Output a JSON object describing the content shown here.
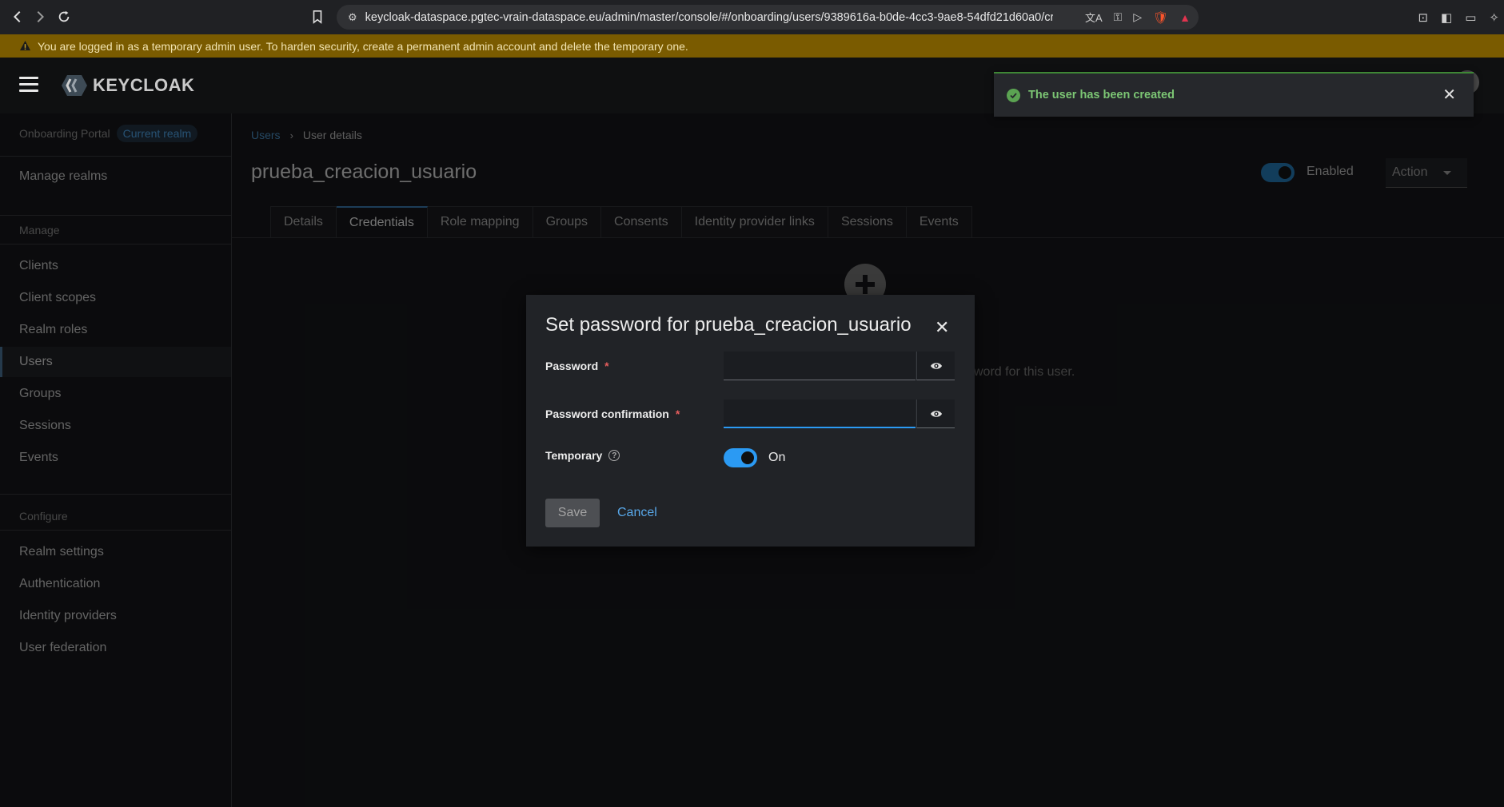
{
  "browser": {
    "url": "keycloak-dataspace.pgtec-vrain-dataspace.eu/admin/master/console/#/onboarding/users/9389616a-b0de-4cc3-9ae8-54dfd21d60a0/cre..."
  },
  "banner": {
    "text": "You are logged in as a temporary admin user. To harden security, create a permanent admin account and delete the temporary one."
  },
  "header": {
    "logo_text": "KEYCLOAK"
  },
  "toast": {
    "message": "The user has been created",
    "status_color": "#3e8635"
  },
  "sidebar": {
    "realm_name": "Onboarding Portal",
    "realm_badge": "Current realm",
    "manage_realms": "Manage realms",
    "section_manage": "Manage",
    "section_configure": "Configure",
    "items": [
      {
        "label": "Clients"
      },
      {
        "label": "Client scopes"
      },
      {
        "label": "Realm roles"
      },
      {
        "label": "Users",
        "active": true
      },
      {
        "label": "Groups"
      },
      {
        "label": "Sessions"
      },
      {
        "label": "Events"
      }
    ],
    "configure_items": [
      {
        "label": "Realm settings"
      },
      {
        "label": "Authentication"
      },
      {
        "label": "Identity providers"
      },
      {
        "label": "User federation"
      }
    ]
  },
  "main": {
    "breadcrumb": {
      "parent": "Users",
      "current": "User details"
    },
    "title": "prueba_creacion_usuario",
    "enabled_label": "Enabled",
    "enabled": true,
    "action_label": "Action",
    "tabs": [
      {
        "label": "Details"
      },
      {
        "label": "Credentials",
        "active": true
      },
      {
        "label": "Role mapping"
      },
      {
        "label": "Groups"
      },
      {
        "label": "Consents"
      },
      {
        "label": "Identity provider links"
      },
      {
        "label": "Sessions"
      },
      {
        "label": "Events"
      }
    ],
    "empty_state_text": "sword for this user."
  },
  "modal": {
    "title": "Set password for prueba_creacion_usuario",
    "password_label": "Password",
    "password_value": "",
    "confirm_label": "Password confirmation",
    "confirm_value": "",
    "required_mark": "*",
    "temporary_label": "Temporary",
    "temporary_state": "On",
    "temporary_on": true,
    "save_label": "Save",
    "cancel_label": "Cancel"
  },
  "colors": {
    "accent_blue": "#2b9af3",
    "banner_bg": "#7a5b00",
    "success_green": "#3e8635"
  }
}
